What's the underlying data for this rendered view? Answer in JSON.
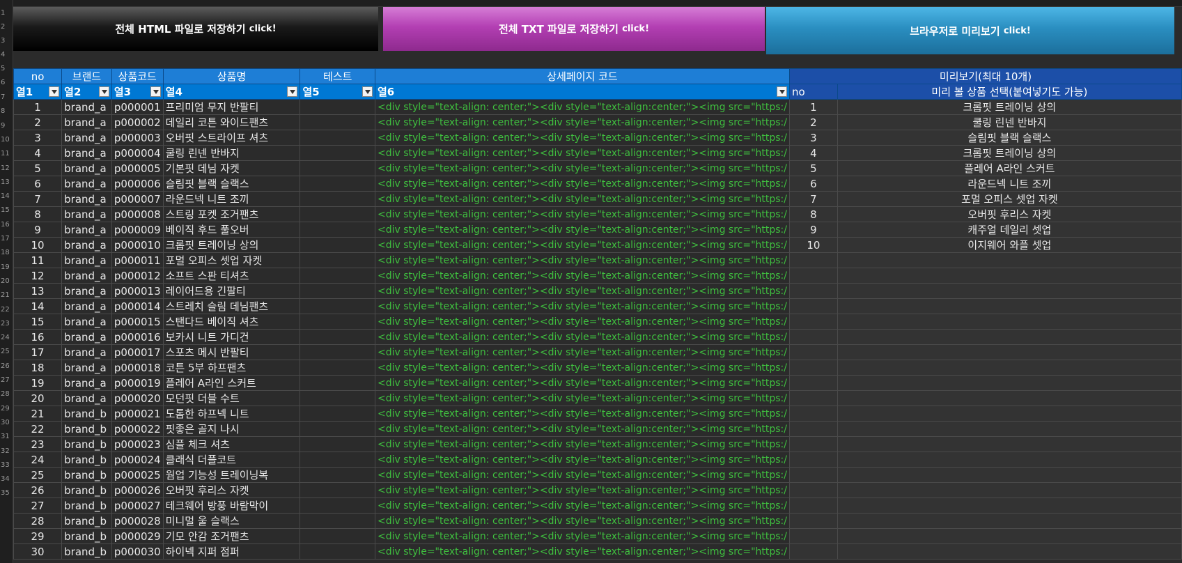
{
  "buttons": {
    "html_label": "전체 HTML 파일로 저장하기",
    "html_suffix": "click!",
    "txt_label": "전체 TXT 파일로 저장하기",
    "txt_suffix": "click!",
    "preview_label": "브라우저로 미리보기",
    "preview_suffix": "click!"
  },
  "header_row1": {
    "no": "no",
    "brand": "브랜드",
    "code": "상품코드",
    "name": "상품명",
    "test": "테스트",
    "detail": "상세페이지 코드",
    "preview": "미리보기(최대 10개)"
  },
  "header_row2": {
    "c1": "열1",
    "c2": "열2",
    "c3": "열3",
    "c4": "열4",
    "c5": "열5",
    "c6": "열6",
    "pv_no": "no",
    "pv_select": "미리 볼 상품 선택(붙여넣기도 가능)"
  },
  "detail_code": "<div style=\"text-align: center;\"><div style=\"text-align:center;\"><img src=\"https:/",
  "rows": [
    {
      "no": "1",
      "brand": "brand_a",
      "code": "p000001",
      "name": "프리미엄 무지 반팔티"
    },
    {
      "no": "2",
      "brand": "brand_a",
      "code": "p000002",
      "name": "데일리 코튼 와이드팬츠"
    },
    {
      "no": "3",
      "brand": "brand_a",
      "code": "p000003",
      "name": "오버핏 스트라이프 셔츠"
    },
    {
      "no": "4",
      "brand": "brand_a",
      "code": "p000004",
      "name": "쿨링 린넨 반바지"
    },
    {
      "no": "5",
      "brand": "brand_a",
      "code": "p000005",
      "name": "기본핏 데님 자켓"
    },
    {
      "no": "6",
      "brand": "brand_a",
      "code": "p000006",
      "name": "슬림핏 블랙 슬랙스"
    },
    {
      "no": "7",
      "brand": "brand_a",
      "code": "p000007",
      "name": "라운드넥 니트 조끼"
    },
    {
      "no": "8",
      "brand": "brand_a",
      "code": "p000008",
      "name": "스트링 포켓 조거팬츠"
    },
    {
      "no": "9",
      "brand": "brand_a",
      "code": "p000009",
      "name": "베이직 후드 풀오버"
    },
    {
      "no": "10",
      "brand": "brand_a",
      "code": "p000010",
      "name": "크롭핏 트레이닝 상의"
    },
    {
      "no": "11",
      "brand": "brand_a",
      "code": "p000011",
      "name": "포멀 오피스 셋업 자켓"
    },
    {
      "no": "12",
      "brand": "brand_a",
      "code": "p000012",
      "name": "소프트 스판 티셔츠"
    },
    {
      "no": "13",
      "brand": "brand_a",
      "code": "p000013",
      "name": "레이어드용 긴팔티"
    },
    {
      "no": "14",
      "brand": "brand_a",
      "code": "p000014",
      "name": "스트레치 슬림 데님팬츠"
    },
    {
      "no": "15",
      "brand": "brand_a",
      "code": "p000015",
      "name": "스탠다드 베이직 셔츠"
    },
    {
      "no": "16",
      "brand": "brand_a",
      "code": "p000016",
      "name": "보카시 니트 가디건"
    },
    {
      "no": "17",
      "brand": "brand_a",
      "code": "p000017",
      "name": "스포츠 메시 반팔티"
    },
    {
      "no": "18",
      "brand": "brand_a",
      "code": "p000018",
      "name": "코튼 5부 하프팬츠"
    },
    {
      "no": "19",
      "brand": "brand_a",
      "code": "p000019",
      "name": "플레어 A라인 스커트"
    },
    {
      "no": "20",
      "brand": "brand_a",
      "code": "p000020",
      "name": "모던핏 더블 수트"
    },
    {
      "no": "21",
      "brand": "brand_b",
      "code": "p000021",
      "name": "도톰한 하프넥 니트"
    },
    {
      "no": "22",
      "brand": "brand_b",
      "code": "p000022",
      "name": "핏좋은 골지 나시"
    },
    {
      "no": "23",
      "brand": "brand_b",
      "code": "p000023",
      "name": "심플 체크 셔츠"
    },
    {
      "no": "24",
      "brand": "brand_b",
      "code": "p000024",
      "name": "클래식 더플코트"
    },
    {
      "no": "25",
      "brand": "brand_b",
      "code": "p000025",
      "name": "웜업 기능성 트레이닝복"
    },
    {
      "no": "26",
      "brand": "brand_b",
      "code": "p000026",
      "name": "오버핏 후리스 자켓"
    },
    {
      "no": "27",
      "brand": "brand_b",
      "code": "p000027",
      "name": "테크웨어 방풍 바람막이"
    },
    {
      "no": "28",
      "brand": "brand_b",
      "code": "p000028",
      "name": "미니멀 울 슬랙스"
    },
    {
      "no": "29",
      "brand": "brand_b",
      "code": "p000029",
      "name": "기모 안감 조거팬츠"
    },
    {
      "no": "30",
      "brand": "brand_b",
      "code": "p000030",
      "name": "하이넥 지퍼 점퍼"
    }
  ],
  "preview_rows": [
    {
      "no": "1",
      "name": "크롭핏 트레이닝 상의"
    },
    {
      "no": "2",
      "name": "쿨링 린넨 반바지"
    },
    {
      "no": "3",
      "name": "슬림핏 블랙 슬랙스"
    },
    {
      "no": "4",
      "name": "크롭핏 트레이닝 상의"
    },
    {
      "no": "5",
      "name": "플레어 A라인 스커트"
    },
    {
      "no": "6",
      "name": "라운드넥 니트 조끼"
    },
    {
      "no": "7",
      "name": "포멀 오피스 셋업 자켓"
    },
    {
      "no": "8",
      "name": "오버핏 후리스 자켓"
    },
    {
      "no": "9",
      "name": "캐주얼 데일리 셋업"
    },
    {
      "no": "10",
      "name": "이지웨어 와플 셋업"
    }
  ],
  "row_numbers": [
    "1",
    "2",
    "3",
    "4",
    "5",
    "6",
    "7",
    "8",
    "9",
    "10",
    "11",
    "12",
    "13",
    "14",
    "15",
    "16",
    "17",
    "18",
    "19",
    "20",
    "21",
    "22",
    "23",
    "24",
    "25",
    "26",
    "27",
    "28",
    "29",
    "30",
    "31",
    "32",
    "33",
    "34",
    "35"
  ]
}
